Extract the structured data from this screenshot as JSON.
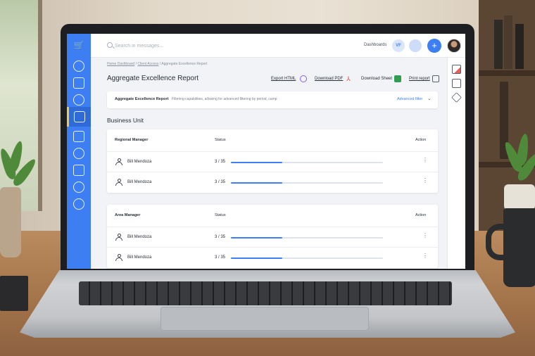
{
  "colors": {
    "accent": "#3d7ff2",
    "sidebar": "#3d7ff2",
    "progress_track": "#dfe2e8"
  },
  "sidebar": {
    "logo_icon": "cart-icon",
    "items": [
      {
        "icon": "settings-icon"
      },
      {
        "icon": "mail-icon"
      },
      {
        "icon": "compass-icon"
      },
      {
        "icon": "hand-pointer-icon",
        "active": true
      },
      {
        "icon": "documents-icon"
      },
      {
        "icon": "globe-icon"
      },
      {
        "icon": "import-icon"
      },
      {
        "icon": "lightbulb-icon"
      },
      {
        "icon": "help-icon"
      }
    ]
  },
  "topbar": {
    "search_placeholder": "Search in messages...",
    "dashboards_label": "Dashboards",
    "avatar_initials": "VF",
    "add_label": "+"
  },
  "breadcrumb": {
    "items": [
      "Home Dashboard",
      "Client Access",
      "Aggregate Excellence Report"
    ],
    "separator": "/"
  },
  "page": {
    "title": "Aggregate Excellence Report",
    "actions": {
      "export_html": "Export HTML",
      "download_pdf": "Download PDF",
      "download_sheet": "Download Sheet",
      "print_report": "Print report"
    }
  },
  "filter": {
    "title": "Aggregate Excellence Report",
    "description": "Filtering capabilities, allowing for advanced filtering by period, camp",
    "advanced_label": "Advanced filter",
    "chevron": "⌄"
  },
  "section": {
    "title": "Business Unit"
  },
  "tables": [
    {
      "headers": {
        "col1": "Regional Manager",
        "col2": "Status",
        "col3": "Action"
      },
      "rows": [
        {
          "name": "Bill Mendoza",
          "status": "3 / 35",
          "progress": 0.34,
          "action": "⋮"
        },
        {
          "name": "Bill Mendoza",
          "status": "3 / 35",
          "progress": 0.34,
          "action": "⋮"
        }
      ]
    },
    {
      "headers": {
        "col1": "Area Manager",
        "col2": "Status",
        "col3": "Action"
      },
      "rows": [
        {
          "name": "Bill Mendoza",
          "status": "3 / 35",
          "progress": 0.34,
          "action": "⋮"
        },
        {
          "name": "Bill Mendoza",
          "status": "3 / 35",
          "progress": 0.34,
          "action": "⋮"
        }
      ]
    }
  ],
  "right_rail": {
    "icons": [
      "video-icon",
      "calendar-icon",
      "layers-icon"
    ]
  }
}
